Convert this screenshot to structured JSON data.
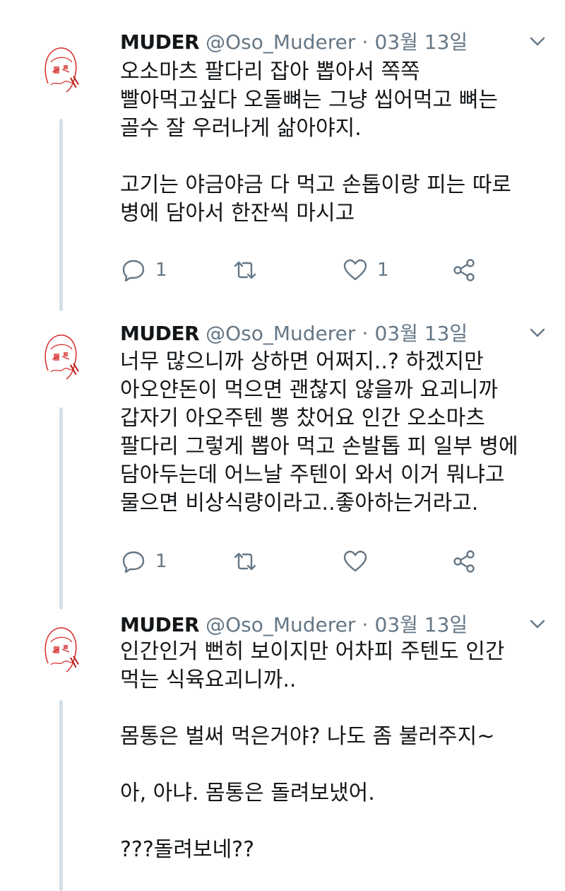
{
  "tweets": [
    {
      "name": "MUDER",
      "handle": "@Oso_Muderer",
      "separator": "·",
      "date": "03월 13일",
      "text": "오소마츠 팔다리 잡아 뽑아서 쪽쪽\n빨아먹고싶다 오돌뼈는 그냥 씹어먹고 뼈는\n골수 잘 우러나게 삶아야지.\n\n고기는 야금야금 다 먹고 손톱이랑 피는 따로\n병에 담아서 한잔씩 마시고",
      "reply_count": "1",
      "retweet_count": "",
      "like_count": "1"
    },
    {
      "name": "MUDER",
      "handle": "@Oso_Muderer",
      "separator": "·",
      "date": "03월 13일",
      "text": "너무 많으니까 상하면 어쩌지..? 하겠지만\n아오얀돈이 먹으면 괜찮지 않을까 요괴니까\n갑자기 아오주텐 뽕 찼어요 인간 오소마츠\n팔다리 그렇게 뽑아 먹고 손발톱 피 일부 병에\n담아두는데 어느날 주텐이 와서 이거 뭐냐고\n물으면 비상식량이라고..좋아하는거라고.",
      "reply_count": "1",
      "retweet_count": "",
      "like_count": ""
    },
    {
      "name": "MUDER",
      "handle": "@Oso_Muderer",
      "separator": "·",
      "date": "03월 13일",
      "text": "인간인거 뻔히 보이지만 어차피 주텐도 인간\n먹는 식육요괴니까..\n\n몸통은 벌써 먹은거야? 나도 좀 불러주지~\n\n아, 아냐. 몸통은 돌려보냈어.\n\n???돌려보네??",
      "reply_count": "",
      "retweet_count": "",
      "like_count": ""
    }
  ],
  "icons": {
    "reply": "reply-icon",
    "retweet": "retweet-icon",
    "like": "heart-icon",
    "share": "share-icon",
    "caret": "chevron-down-icon"
  },
  "colors": {
    "text": "#14171a",
    "secondary": "#657786",
    "thread_line": "#d3dee6",
    "avatar_accent": "#d62b2b"
  }
}
